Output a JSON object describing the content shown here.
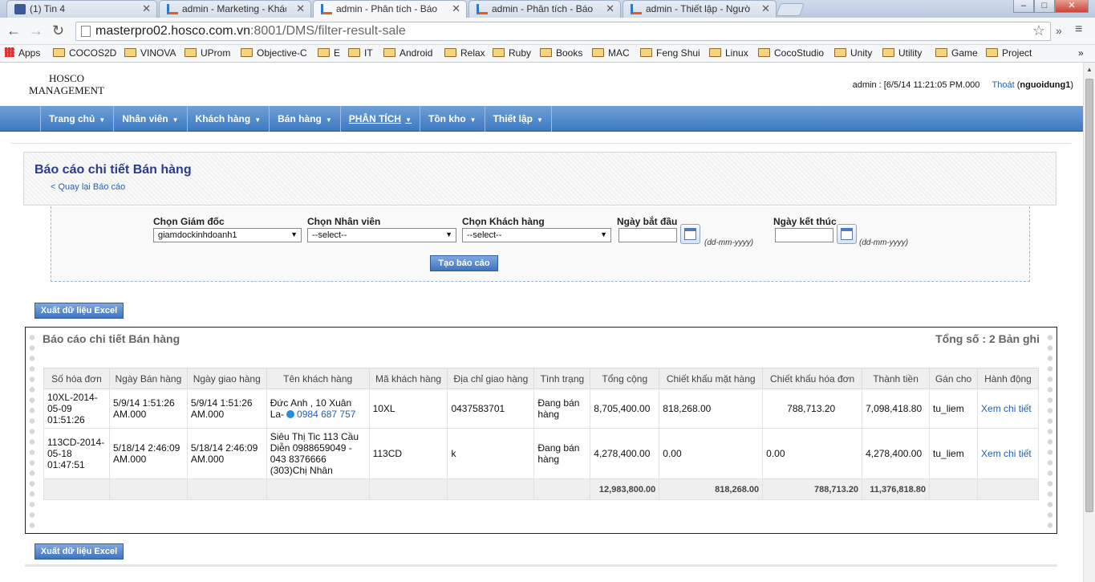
{
  "browser": {
    "tabs": [
      {
        "label": "(1) Tin 4",
        "icon": "facebook-icon"
      },
      {
        "label": "admin - Marketing - Khách",
        "icon": "app-icon"
      },
      {
        "label": "admin - Phân tích - Báo cá",
        "icon": "app-icon"
      },
      {
        "label": "admin - Phân tích - Báo cá",
        "icon": "app-icon"
      },
      {
        "label": "admin - Thiết lập - Người",
        "icon": "app-icon"
      }
    ],
    "url_host": "masterpro02.hosco.com.vn",
    "url_rest": ":8001/DMS/filter-result-sale",
    "bookmarks": [
      "Apps",
      "COCOS2D",
      "VINOVA",
      "UProm",
      "Objective-C",
      "E",
      "IT",
      "Android",
      "Relax",
      "Ruby",
      "Books",
      "MAC",
      "Feng Shui",
      "Linux",
      "CocoStudio",
      "Unity",
      "Utility",
      "Game",
      "Project"
    ],
    "more": "»"
  },
  "header": {
    "logo_line1": "HOSCO",
    "logo_line2": "MANAGEMENT",
    "user_info": "admin : [6/5/14 11:21:05 PM.000",
    "logout": "Thoát",
    "username": "nguoidung1"
  },
  "menu": [
    "Trang chủ",
    "Nhân viên",
    "Khách hàng",
    "Bán hàng",
    "PHÂN TÍCH",
    "Tồn kho",
    "Thiết lập"
  ],
  "page": {
    "title": "Báo cáo chi tiết Bán hàng",
    "back_link": "< Quay lại Báo cáo"
  },
  "filters": {
    "director_label": "Chọn Giám đốc",
    "director_value": "giamdockinhdoanh1",
    "staff_label": "Chọn Nhân viên",
    "staff_value": "--select--",
    "customer_label": "Chọn Khách hàng",
    "customer_value": "--select--",
    "start_label": "Ngày bắt đầu",
    "end_label": "Ngày kết thúc",
    "date_hint": "(dd-mm-yyyy)",
    "submit": "Tạo báo cáo"
  },
  "export_label": "Xuất dữ liệu Excel",
  "report": {
    "title": "Báo cáo chi tiết Bán hàng",
    "total": "Tổng số : 2 Bản ghi",
    "columns": [
      "Số hóa đơn",
      "Ngày Bán hàng",
      "Ngày giao hàng",
      "Tên khách hàng",
      "Mã khách hàng",
      "Địa chỉ giao hàng",
      "Tình trạng",
      "Tổng cộng",
      "Chiết khấu mặt hàng",
      "Chiết khấu hóa đơn",
      "Thành tiền",
      "Gán cho",
      "Hành động"
    ],
    "rows": [
      {
        "invoice": "10XL-2014-05-09 01:51:26",
        "sale_date": "5/9/14 1:51:26 AM.000",
        "delivery_date": "5/9/14 1:51:26 AM.000",
        "customer_name": "Đức Anh , 10 Xuân La-",
        "customer_phone": "0984 687 757",
        "customer_code": "10XL",
        "address": "0437583701",
        "status": "Đang bán hàng",
        "total": "8,705,400.00",
        "item_discount": "818,268.00",
        "invoice_discount": "788,713.20",
        "amount": "7,098,418.80",
        "assigned": "tu_liem",
        "action": "Xem chi tiết"
      },
      {
        "invoice": "113CD-2014-05-18 01:47:51",
        "sale_date": "5/18/14 2:46:09 AM.000",
        "delivery_date": "5/18/14 2:46:09 AM.000",
        "customer_name": "Siêu Thị Tic 113 Cầu Diễn 0988659049 - 043 8376666 (303)Chị Nhân",
        "customer_phone": "",
        "customer_code": "113CD",
        "address": "k",
        "status": "Đang bán hàng",
        "total": "4,278,400.00",
        "item_discount": "0.00",
        "invoice_discount": "0.00",
        "amount": "4,278,400.00",
        "assigned": "tu_liem",
        "action": "Xem chi tiết"
      }
    ],
    "sum": {
      "total": "12,983,800.00",
      "item_discount": "818,268.00",
      "invoice_discount": "788,713.20",
      "amount": "11,376,818.80"
    }
  }
}
